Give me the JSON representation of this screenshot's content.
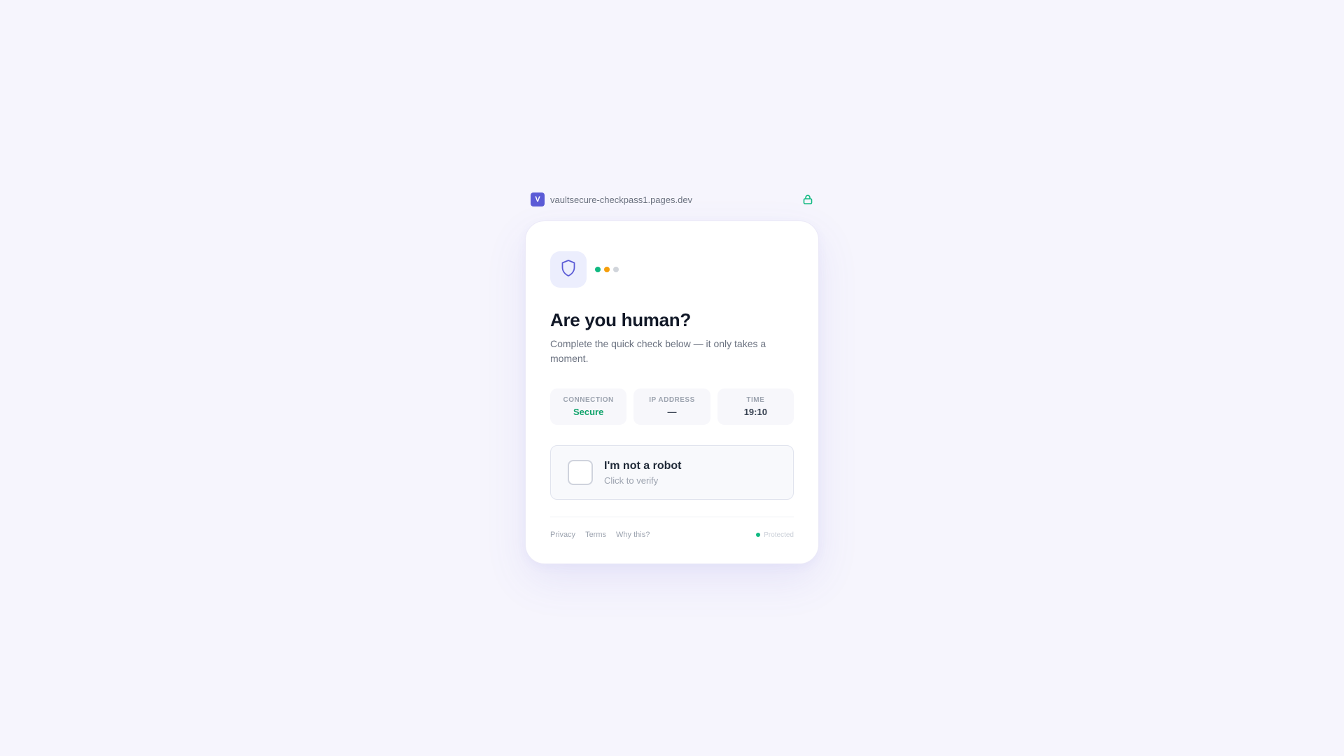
{
  "site": {
    "favicon_letter": "V",
    "domain": "vaultsecure-checkpass1.pages.dev",
    "lock_icon": "lock-icon"
  },
  "card": {
    "icon": "shield-icon",
    "status_dots": [
      "#10b981",
      "#f59e0b",
      "#d1d5db"
    ],
    "title": "Are you human?",
    "subtitle": "Complete the quick check below — it only takes a moment.",
    "stats": [
      {
        "label": "CONNECTION",
        "value": "Secure"
      },
      {
        "label": "IP ADDRESS",
        "value": "—"
      },
      {
        "label": "TIME",
        "value": "19:10"
      }
    ],
    "captcha": {
      "title": "I'm not a robot",
      "subtitle": "Click to verify",
      "checked": false
    },
    "footer": {
      "links": [
        "Privacy",
        "Terms",
        "Why this?"
      ],
      "status": "Protected"
    }
  },
  "colors": {
    "accent": "#5b5bd6",
    "success": "#10b981",
    "background": "#f6f5fd"
  }
}
